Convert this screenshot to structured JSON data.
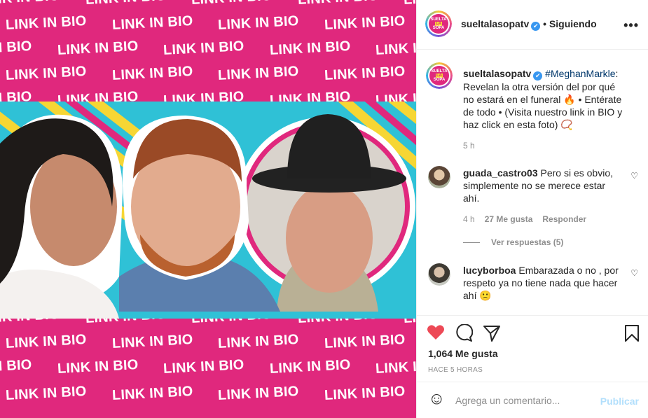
{
  "media": {
    "banner_text": "LINK IN BIO"
  },
  "header": {
    "username": "sueltalasopatv",
    "verified_mark": "✔",
    "follow_status": "Siguiendo",
    "separator": "•",
    "more_label": "•••",
    "logo_line1": "SUELTA",
    "logo_line2": "LA",
    "logo_line3": "SOPA"
  },
  "caption": {
    "username": "sueltalasopatv",
    "hashtag": "#MeghanMarkle",
    "text": ": Revelan la otra versión del por qué no estará en el funeral 🔥 • Entérate de todo • (Visita nuestro link in BIO y haz click en esta foto) 📿",
    "time": "5 h"
  },
  "comments": [
    {
      "username": "guada_castro03",
      "text": "Pero si es obvio, simplemente no se merece estar ahí.",
      "time": "4 h",
      "likes": "27 Me gusta",
      "reply": "Responder",
      "view_replies": "Ver respuestas (5)"
    },
    {
      "username": "lucyborboa",
      "text": "Embarazada o no , por respeto ya no tiene nada que hacer ahí 🙁"
    }
  ],
  "actions": {
    "likes": "1,064 Me gusta",
    "time_ago": "HACE 5 HORAS",
    "like_color": "#ed4956"
  },
  "add_comment": {
    "emoji_icon": "☺",
    "placeholder": "Agrega un comentario...",
    "post_label": "Publicar"
  },
  "colors": {
    "brand_pink": "#e0287d",
    "accent_cyan": "#2fc1d6",
    "link_blue": "#00376b",
    "verified_blue": "#3897f0"
  }
}
